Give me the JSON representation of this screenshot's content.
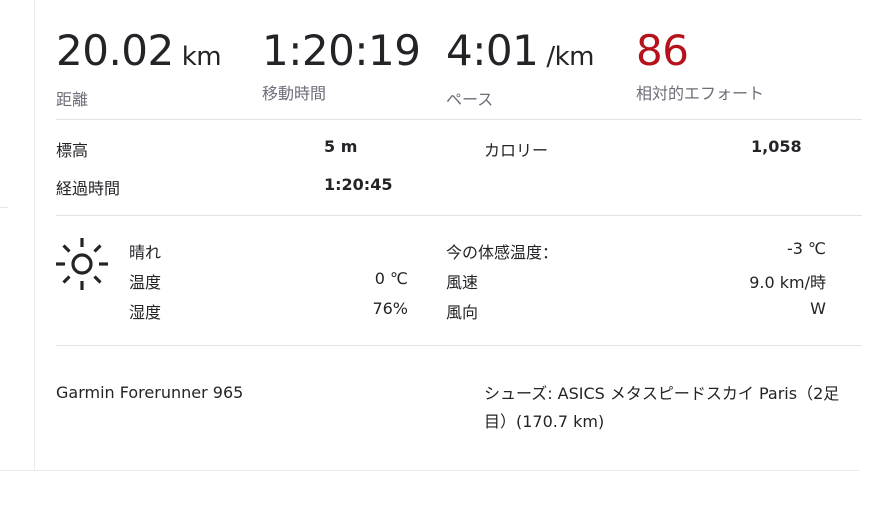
{
  "primary_stats": [
    {
      "value": "20.02",
      "unit": "km",
      "label": "距離"
    },
    {
      "value": "1:20:19",
      "unit": "",
      "label": "移動時間"
    },
    {
      "value": "4:01",
      "unit": "/km",
      "label": "ペース"
    },
    {
      "value": "86",
      "unit": "",
      "label": "相対的エフォート"
    }
  ],
  "secondary_stats": {
    "elevation_label": "標高",
    "elevation_value": "5 m",
    "calories_label": "カロリー",
    "calories_value": "1,058",
    "elapsed_label": "経過時間",
    "elapsed_value": "1:20:45"
  },
  "weather": {
    "icon": "sun-icon",
    "condition": "晴れ",
    "temp_label": "温度",
    "temp_value": "0 ℃",
    "humidity_label": "湿度",
    "humidity_value": "76%",
    "feels_like_label": "今の体感温度：",
    "feels_like_value": "-3 ℃",
    "wind_speed_label": "風速",
    "wind_speed_value": "9.0 km/時",
    "wind_dir_label": "風向",
    "wind_dir_value": "W"
  },
  "gear": {
    "device": "Garmin Forerunner 965",
    "shoes": "シューズ: ASICS メタスピードスカイ Paris（2足目）(170.7 km)"
  },
  "colors": {
    "accent": "#b6121b",
    "label_gray": "#6d6d78",
    "text": "#242428"
  }
}
